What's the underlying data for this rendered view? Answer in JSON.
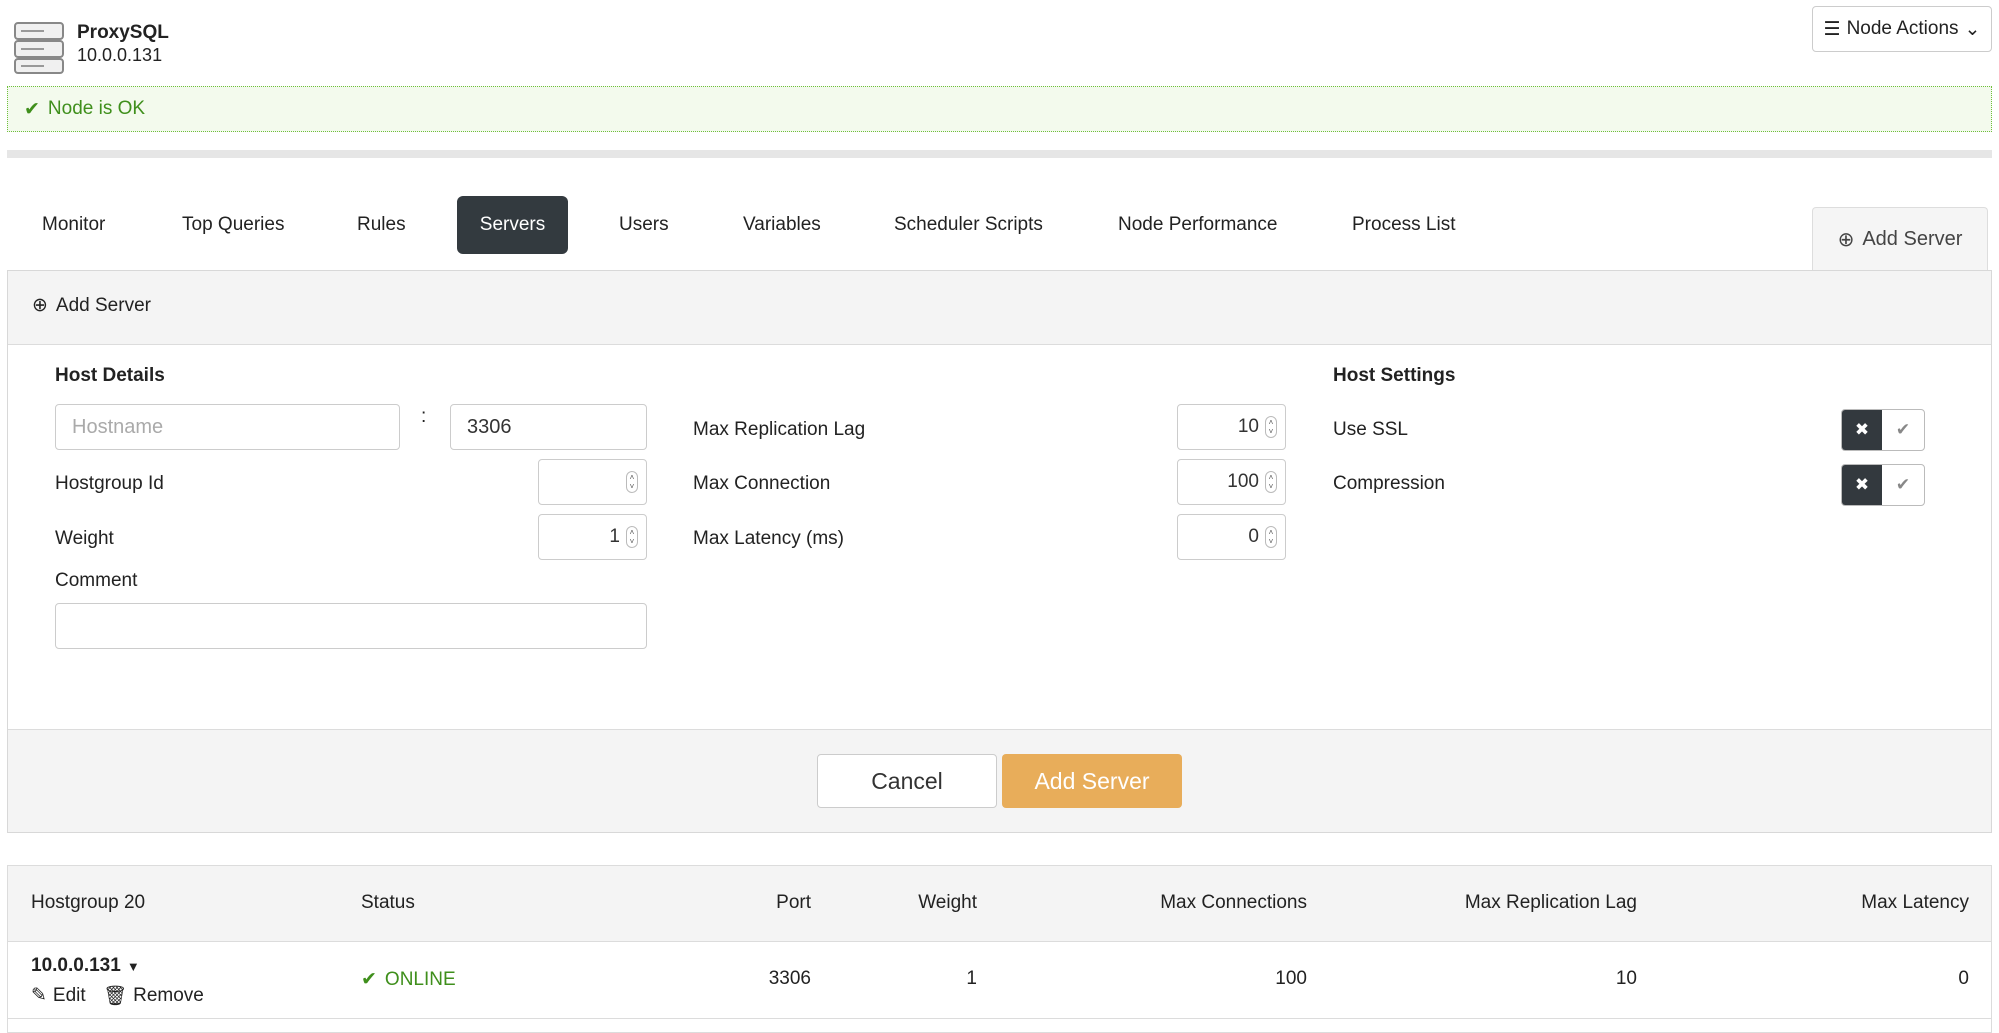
{
  "node": {
    "name": "ProxySQL",
    "ip": "10.0.0.131",
    "actions_label": "Node Actions",
    "status": "Node is OK"
  },
  "tabs": [
    {
      "label": "Monitor"
    },
    {
      "label": "Top Queries"
    },
    {
      "label": "Rules"
    },
    {
      "label": "Servers",
      "active": true
    },
    {
      "label": "Users"
    },
    {
      "label": "Variables"
    },
    {
      "label": "Scheduler Scripts"
    },
    {
      "label": "Node Performance"
    },
    {
      "label": "Process List"
    }
  ],
  "add_server_tab": "Add Server",
  "form": {
    "title": "Add Server",
    "host_details": "Host Details",
    "hostname_placeholder": "Hostname",
    "port_separator": ":",
    "port": "3306",
    "hostgroup_label": "Hostgroup Id",
    "hostgroup_value": "",
    "weight_label": "Weight",
    "weight_value": "1",
    "comment_label": "Comment",
    "comment_value": "",
    "max_replication_lag_label": "Max Replication Lag",
    "max_replication_lag_value": "10",
    "max_connection_label": "Max Connection",
    "max_connection_value": "100",
    "max_latency_label": "Max Latency (ms)",
    "max_latency_value": "0",
    "host_settings": "Host Settings",
    "use_ssl_label": "Use SSL",
    "compression_label": "Compression",
    "cancel": "Cancel",
    "submit": "Add Server"
  },
  "table": {
    "headers": {
      "hostgroup": "Hostgroup 20",
      "status": "Status",
      "port": "Port",
      "weight": "Weight",
      "max_connections": "Max Connections",
      "max_replication_lag": "Max Replication Lag",
      "max_latency": "Max Latency"
    },
    "row": {
      "host": "10.0.0.131",
      "edit": "Edit",
      "remove": "Remove",
      "status": "ONLINE",
      "port": "3306",
      "weight": "1",
      "max_connections": "100",
      "max_replication_lag": "10",
      "max_latency": "0"
    }
  },
  "colors": {
    "accent": "#e8ad5a",
    "ok_green": "#3f8f1c",
    "dark": "#33393e"
  }
}
